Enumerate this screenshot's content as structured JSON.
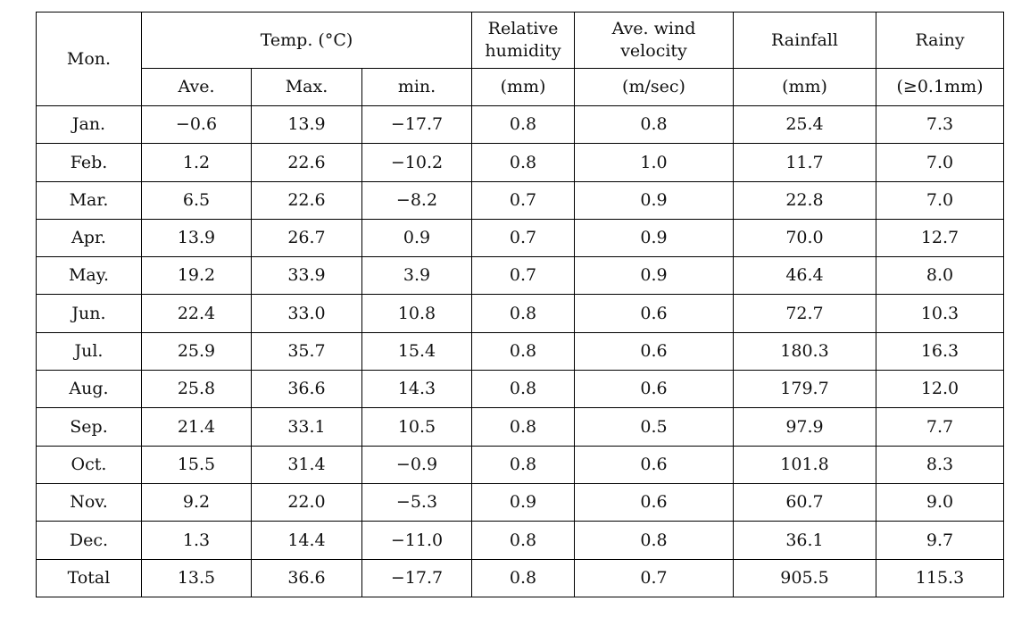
{
  "table": {
    "headers": {
      "month": "Mon.",
      "temp_group": "Temp. (°C)",
      "temp_sub": [
        "Ave.",
        "Max.",
        "min."
      ],
      "humidity": [
        "Relative",
        "humidity"
      ],
      "humidity_unit": "(mm)",
      "wind": [
        "Ave. wind",
        "velocity"
      ],
      "wind_unit": "(m/sec)",
      "rainfall": "Rainfall",
      "rainfall_unit": "(mm)",
      "rainy": "Rainy",
      "rainy_unit": "(≥0.1mm)"
    },
    "rows": [
      [
        "Jan.",
        "−0.6",
        "13.9",
        "−17.7",
        "0.8",
        "0.8",
        "25.4",
        "7.3"
      ],
      [
        "Feb.",
        "1.2",
        "22.6",
        "−10.2",
        "0.8",
        "1.0",
        "11.7",
        "7.0"
      ],
      [
        "Mar.",
        "6.5",
        "22.6",
        "−8.2",
        "0.7",
        "0.9",
        "22.8",
        "7.0"
      ],
      [
        "Apr.",
        "13.9",
        "26.7",
        "0.9",
        "0.7",
        "0.9",
        "70.0",
        "12.7"
      ],
      [
        "May.",
        "19.2",
        "33.9",
        "3.9",
        "0.7",
        "0.9",
        "46.4",
        "8.0"
      ],
      [
        "Jun.",
        "22.4",
        "33.0",
        "10.8",
        "0.8",
        "0.6",
        "72.7",
        "10.3"
      ],
      [
        "Jul.",
        "25.9",
        "35.7",
        "15.4",
        "0.8",
        "0.6",
        "180.3",
        "16.3"
      ],
      [
        "Aug.",
        "25.8",
        "36.6",
        "14.3",
        "0.8",
        "0.6",
        "179.7",
        "12.0"
      ],
      [
        "Sep.",
        "21.4",
        "33.1",
        "10.5",
        "0.8",
        "0.5",
        "97.9",
        "7.7"
      ],
      [
        "Oct.",
        "15.5",
        "31.4",
        "−0.9",
        "0.8",
        "0.6",
        "101.8",
        "8.3"
      ],
      [
        "Nov.",
        "9.2",
        "22.0",
        "−5.3",
        "0.9",
        "0.6",
        "60.7",
        "9.0"
      ],
      [
        "Dec.",
        "1.3",
        "14.4",
        "−11.0",
        "0.8",
        "0.8",
        "36.1",
        "9.7"
      ],
      [
        "Total",
        "13.5",
        "36.6",
        "−17.7",
        "0.8",
        "0.7",
        "905.5",
        "115.3"
      ]
    ]
  }
}
